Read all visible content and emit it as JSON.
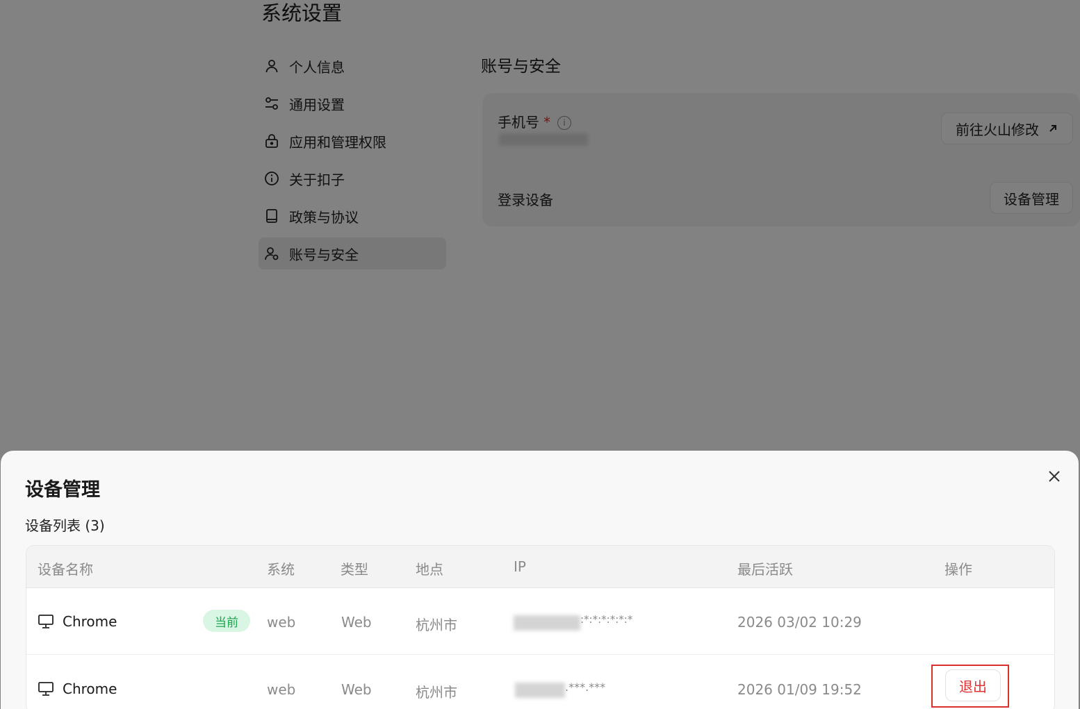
{
  "settings": {
    "page_title": "系统设置",
    "sidebar": {
      "items": [
        {
          "label": "个人信息",
          "icon": "user-icon"
        },
        {
          "label": "通用设置",
          "icon": "sliders-icon"
        },
        {
          "label": "应用和管理权限",
          "icon": "lock-icon"
        },
        {
          "label": "关于扣子",
          "icon": "info-icon"
        },
        {
          "label": "政策与协议",
          "icon": "book-icon"
        },
        {
          "label": "账号与安全",
          "icon": "user-settings-icon",
          "active": true
        }
      ]
    },
    "section_title": "账号与安全",
    "phone": {
      "label": "手机号",
      "required_mark": "*",
      "info_icon": "info-circle-icon",
      "button_label": "前往火山修改",
      "button_icon": "external-arrow-icon"
    },
    "devices": {
      "label": "登录设备",
      "button_label": "设备管理"
    }
  },
  "modal": {
    "title": "设备管理",
    "list_title": "设备列表 (3)",
    "close_icon": "close-icon",
    "columns": [
      "设备名称",
      "系统",
      "类型",
      "地点",
      "IP",
      "最后活跃",
      "操作"
    ],
    "rows": [
      {
        "device": "Chrome",
        "badge": "当前",
        "system": "web",
        "type": "Web",
        "location": "杭州市",
        "ip_suffix": ":*:*:*:*:*:*",
        "last_active": "2026 03/02 10:29",
        "action": ""
      },
      {
        "device": "Chrome",
        "badge": "",
        "system": "web",
        "type": "Web",
        "location": "杭州市",
        "ip_suffix": ".***.***",
        "last_active": "2026 01/09 19:52",
        "action": "退出"
      }
    ],
    "colors": {
      "badge_bg": "#d9f5e3",
      "badge_text": "#1aa64b",
      "danger": "#e03131",
      "highlight_border": "#d9302a"
    }
  }
}
